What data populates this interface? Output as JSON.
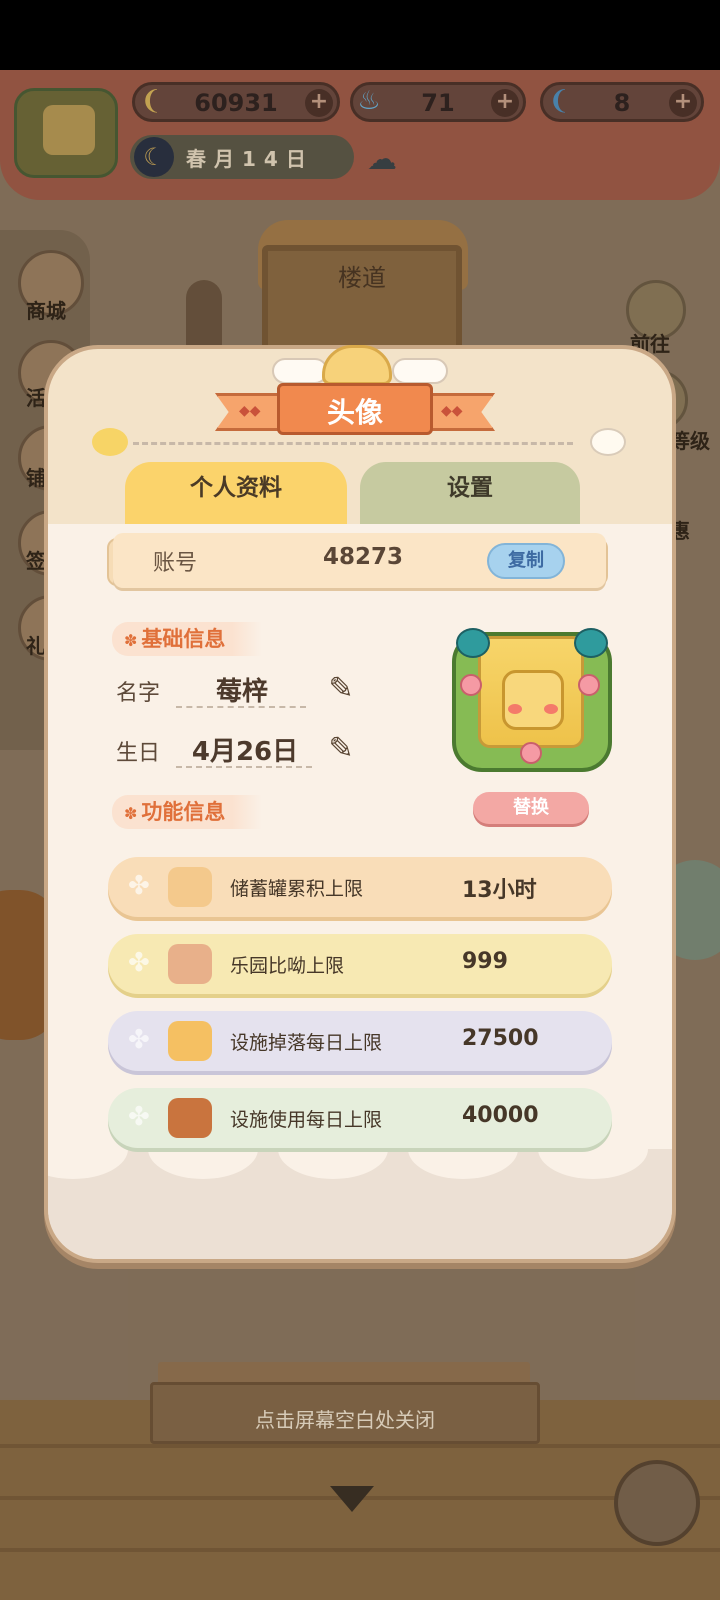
{
  "hud": {
    "bananas": "60931",
    "energy": "71",
    "feathers": "8",
    "date": "春月14日",
    "plus": "+"
  },
  "scene": {
    "door_label": "楼道",
    "left_menu": [
      "商城",
      "活",
      "铺",
      "签",
      "礼"
    ],
    "right_menu": [
      "前往",
      "等级",
      "惠"
    ],
    "close_hint": "点击屏幕空白处关闭"
  },
  "dialog": {
    "title": "头像",
    "tabs": [
      {
        "label": "个人资料",
        "active": true
      },
      {
        "label": "设置",
        "active": false
      }
    ],
    "account": {
      "label": "账号",
      "value": "48273",
      "copy_label": "复制"
    },
    "basic_section": "基础信息",
    "name": {
      "label": "名字",
      "value": "莓梓"
    },
    "birthday": {
      "label": "生日",
      "value": "4月26日"
    },
    "swap_label": "替换",
    "function_section": "功能信息",
    "limits": [
      {
        "name": "储蓄罐累积上限",
        "value": "13小时"
      },
      {
        "name": "乐园比呦上限",
        "value": "999"
      },
      {
        "name": "设施掉落每日上限",
        "value": "27500"
      },
      {
        "name": "设施使用每日上限",
        "value": "40000"
      }
    ]
  },
  "icons": {
    "clover": "✤",
    "section_mark": "✽",
    "pencil": "✎",
    "moon": "☾",
    "weather": "☁"
  },
  "colors": {
    "accent_orange": "#f1894e",
    "tab_active": "#fbd36b",
    "tab_inactive": "#c6caa0",
    "copy_button": "#a7d2ee",
    "swap_button": "#f3a8a4"
  }
}
